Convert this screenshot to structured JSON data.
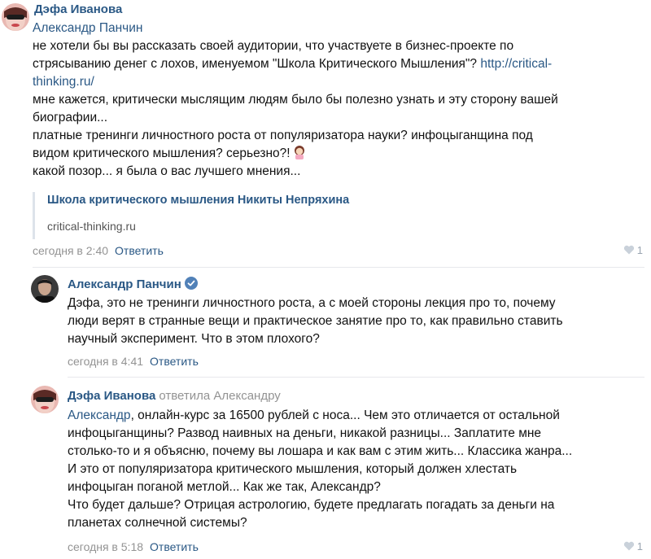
{
  "comments": [
    {
      "author": "Дэфа Иванова",
      "mention_line": "Александр Панчин",
      "lines": [
        "не хотели бы вы рассказать своей аудитории, что участвуете в бизнес-проекте по",
        "стрясыванию денег с лохов, именуемом \"Школа Критического Мышления\"?",
        "thinking.ru/",
        "мне кажется, критически мыслящим людям было бы полезно узнать и эту сторону вашей",
        "биографии...",
        "платные тренинги личностного роста от популяризатора науки? инфоцыганщина под",
        "видом критического мышления? серьезно?!",
        "какой позор... я была о вас лучшего мнения..."
      ],
      "link_part": "http://critical-",
      "snippet": {
        "title": "Школа критического мышления Никиты Непряхина",
        "domain": "critical-thinking.ru"
      },
      "time": "сегодня в 2:40",
      "reply_label": "Ответить",
      "likes": "1"
    },
    {
      "author": "Александр Панчин",
      "verified": true,
      "lines": [
        "Дэфа, это не тренинги личностного роста, а с моей стороны лекция про то, почему",
        "люди верят в странные вещи и практическое занятие про то, как правильно ставить",
        "научный эксперимент. Что в этом плохого?"
      ],
      "time": "сегодня в 4:41",
      "reply_label": "Ответить"
    },
    {
      "author": "Дэфа Иванова",
      "reply_to": "ответила Александру",
      "mention": "Александр",
      "lines": [
        ", онлайн-курс за 16500 рублей с носа... Чем это отличается от остальной",
        "инфоцыганщины? Развод наивных на деньги, никакой разницы... Заплатите мне",
        "столько-то и я объясню, почему вы лошара и как вам с этим жить... Классика жанра...",
        "И это от популяризатора критического мышления, который должен хлестать",
        "инфоцыган поганой метлой... Как же так, Александр?",
        "Что будет дальше? Отрицая астрологию, будете предлагать погадать за деньги на",
        "планетах солнечной системы?"
      ],
      "time": "сегодня в 5:18",
      "reply_label": "Ответить",
      "likes": "1"
    }
  ],
  "colors": {
    "link": "#2a5885",
    "meta": "#939393",
    "divider": "#e7e8ec"
  }
}
